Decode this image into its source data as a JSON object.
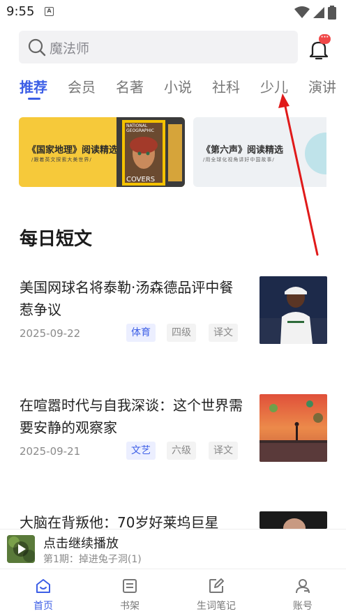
{
  "status_bar": {
    "time": "9:55",
    "notification_letter": "A"
  },
  "search": {
    "placeholder": "魔法师",
    "bell_badge": "···"
  },
  "tabs": [
    {
      "label": "推荐",
      "active": true
    },
    {
      "label": "会员"
    },
    {
      "label": "名著"
    },
    {
      "label": "小说"
    },
    {
      "label": "社科"
    },
    {
      "label": "少儿"
    },
    {
      "label": "演讲"
    }
  ],
  "banners": [
    {
      "title": "《国家地理》阅读精选",
      "subtitle": "/跟着英文探索大美世界/",
      "magazine_lines": [
        "NATIONAL",
        "GEOGRAPHIC",
        "COVERS"
      ]
    },
    {
      "title": "《第六声》阅读精选",
      "subtitle": "/用全球化视角讲好中国故事/"
    }
  ],
  "section": {
    "title": "每日短文"
  },
  "articles": [
    {
      "title": "美国网球名将泰勒·汤森德品评中餐惹争议",
      "date": "2025-09-22",
      "tags": [
        "体育",
        "四级",
        "译文"
      ]
    },
    {
      "title": "在喧嚣时代与自我深谈：这个世界需要安静的观察家",
      "date": "2025-09-21",
      "tags": [
        "文艺",
        "六级",
        "译文"
      ]
    },
    {
      "title": "大脑在背叛他：70岁好莱坞巨星",
      "date": "",
      "tags": []
    }
  ],
  "player": {
    "title": "点击继续播放",
    "subtitle": "第1期：掉进兔子洞(1)"
  },
  "nav": [
    {
      "label": "首页",
      "icon": "home-icon",
      "active": true
    },
    {
      "label": "书架",
      "icon": "bookshelf-icon"
    },
    {
      "label": "生词笔记",
      "icon": "note-edit-icon"
    },
    {
      "label": "账号",
      "icon": "account-icon"
    }
  ],
  "colors": {
    "accent": "#3c5ee6",
    "badge": "#f04848",
    "banner_yellow": "#f6c93a",
    "annotation_arrow": "#e01a1a"
  }
}
